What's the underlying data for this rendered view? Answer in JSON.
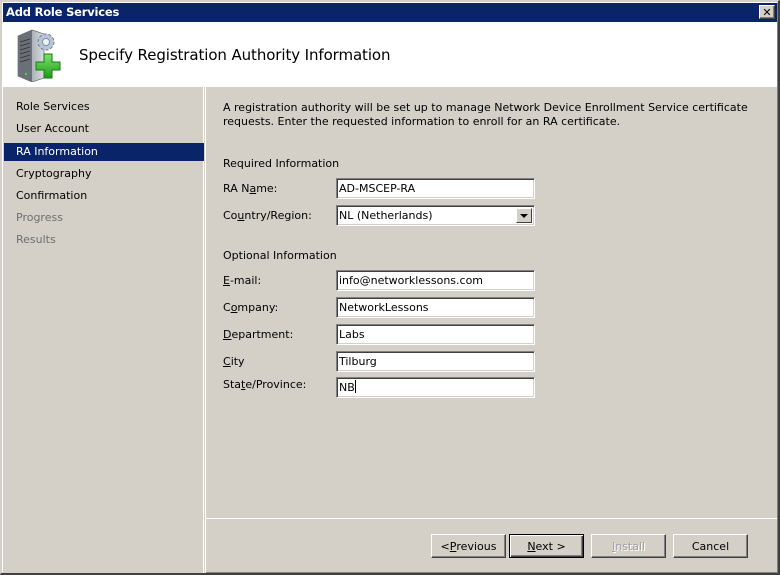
{
  "window": {
    "title": "Add Role Services",
    "close_icon": "close-x-icon"
  },
  "header": {
    "icon": "server-gear-add-icon",
    "title": "Specify Registration Authority Information"
  },
  "sidebar": {
    "items": [
      {
        "label": "Role Services",
        "state": "normal"
      },
      {
        "label": "User Account",
        "state": "normal"
      },
      {
        "label": "RA Information",
        "state": "active"
      },
      {
        "label": "Cryptography",
        "state": "normal"
      },
      {
        "label": "Confirmation",
        "state": "normal"
      },
      {
        "label": "Progress",
        "state": "disabled"
      },
      {
        "label": "Results",
        "state": "disabled"
      }
    ]
  },
  "content": {
    "description": "A registration authority will be set up to manage Network Device Enrollment Service certificate requests. Enter the requested information to enroll for an RA certificate.",
    "required_section": "Required Information",
    "optional_section": "Optional Information",
    "fields": {
      "ra_name": {
        "label_pre": "RA N",
        "label_key": "a",
        "label_post": "me:",
        "value": "AD-MSCEP-RA"
      },
      "country": {
        "label_pre": "Co",
        "label_key": "u",
        "label_post": "ntry/Region:",
        "value": "NL (Netherlands)"
      },
      "email": {
        "label_pre": "",
        "label_key": "E",
        "label_post": "-mail:",
        "value": "info@networklessons.com"
      },
      "company": {
        "label_pre": "C",
        "label_key": "o",
        "label_post": "mpany:",
        "value": "NetworkLessons"
      },
      "department": {
        "label_pre": "",
        "label_key": "D",
        "label_post": "epartment:",
        "value": "Labs"
      },
      "city": {
        "label_pre": "",
        "label_key": "C",
        "label_post": "ity",
        "value": "Tilburg"
      },
      "state": {
        "label_pre": "Sta",
        "label_key": "t",
        "label_post": "e/Province:",
        "value": "NB"
      }
    }
  },
  "buttons": {
    "previous": {
      "pre": "< ",
      "key": "P",
      "post": "revious"
    },
    "next": {
      "pre": "",
      "key": "N",
      "post": "ext >"
    },
    "install": {
      "pre": "",
      "key": "I",
      "post": "nstall"
    },
    "cancel": {
      "pre": "",
      "key": "",
      "post": "Cancel"
    }
  },
  "colors": {
    "titlebar": "#0a246a",
    "selection": "#0a246a",
    "face": "#d4d0c8",
    "header_bg": "#ffffff"
  }
}
